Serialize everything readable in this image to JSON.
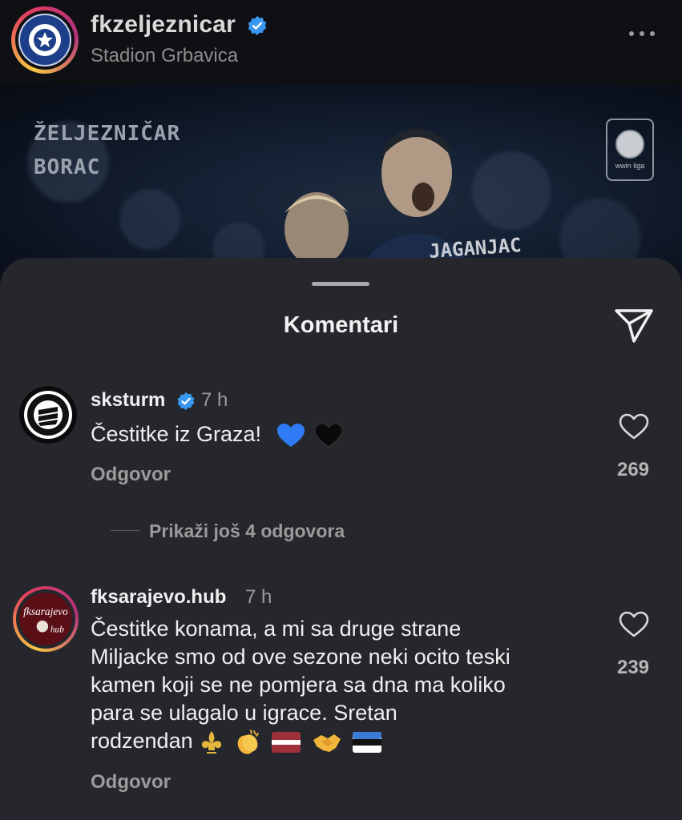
{
  "post_header": {
    "username": "fkzeljeznicar",
    "location": "Stadion Grbavica",
    "verified_icon": "verified-badge-icon",
    "more_icon": "more-options-icon"
  },
  "post_image": {
    "teams": [
      "ŽELJEZNIČAR",
      "BORAC"
    ],
    "badge_text": "wwin liga",
    "jersey_name": "JAGANJAC"
  },
  "comments_sheet": {
    "title": "Komentari",
    "send_icon": "send-icon"
  },
  "comments": [
    {
      "username": "sksturm",
      "verified": true,
      "time": "7 h",
      "text": "Čestitke iz Graza!",
      "emojis": [
        "blue-heart",
        "black-heart"
      ],
      "reply_label": "Odgovor",
      "likes": "269",
      "more_replies": "Prikaži još 4 odgovora"
    },
    {
      "username": "fksarajevo.hub",
      "verified": false,
      "time": "7 h",
      "text_lines": [
        "Čestitke konama, a mi sa druge strane",
        "Miljacke smo od ove sezone neki ocito teski",
        "kamen koji se ne pomjera sa dna ma koliko",
        "para se ulagalo u igrace. Sretan",
        "rodzendan"
      ],
      "emojis": [
        "fleur-de-lis",
        "clapping-hands",
        "latvia-flag",
        "handshake",
        "estonia-flag"
      ],
      "reply_label": "Odgovor",
      "likes": "239"
    }
  ],
  "colors": {
    "sheet_bg": "#25272c",
    "header_bg": "#0f1013",
    "verified_blue": "#3897f0",
    "secondary_text": "#9b9b9b"
  }
}
